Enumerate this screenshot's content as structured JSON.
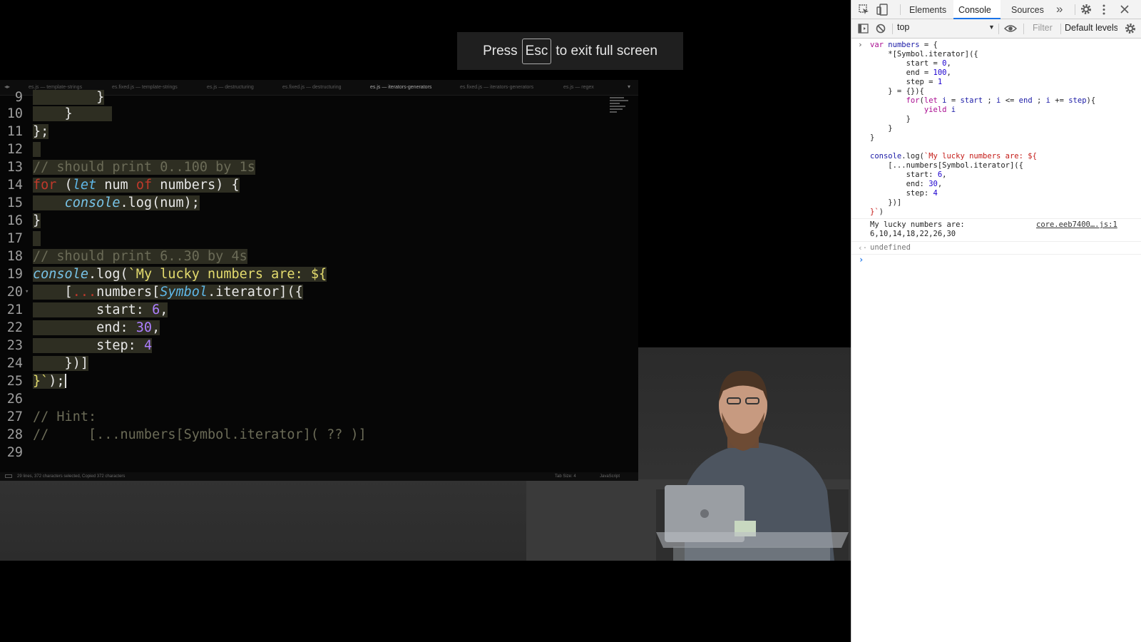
{
  "fullscreen_toast": {
    "prefix": "Press",
    "key": "Esc",
    "suffix": "to exit full screen"
  },
  "editor": {
    "tabs": [
      {
        "label": "es.js — template-strings",
        "active": false
      },
      {
        "label": "es.fixed.js — template-strings",
        "active": false
      },
      {
        "label": "es.js — destructuring",
        "active": false
      },
      {
        "label": "es.fixed.js — destructuring",
        "active": false
      },
      {
        "label": "es.js — iterators-generators",
        "active": true
      },
      {
        "label": "es.fixed.js — iterators-generators",
        "active": false
      },
      {
        "label": "es.js — regex",
        "active": false
      }
    ],
    "status": {
      "left": "29 lines, 372 characters selected, Copied 372 characters",
      "tab_size": "Tab Size: 4",
      "language": "JavaScript"
    }
  },
  "devtools": {
    "tabs": {
      "elements": "Elements",
      "console": "Console",
      "sources": "Sources",
      "more": "»"
    },
    "context": "top",
    "filter_placeholder": "Filter",
    "levels": "Default levels",
    "output": {
      "line1": "My lucky numbers are:",
      "line2": "6,10,14,18,22,26,30",
      "source": "core.eeb7400….js:1",
      "return_value": "undefined"
    }
  },
  "icons": [
    "inspect-icon",
    "device-toolbar-icon",
    "settings-icon",
    "kebab-menu-icon",
    "close-icon",
    "sidebar-toggle-icon",
    "clear-console-icon",
    "eye-icon",
    "console-settings-icon"
  ]
}
